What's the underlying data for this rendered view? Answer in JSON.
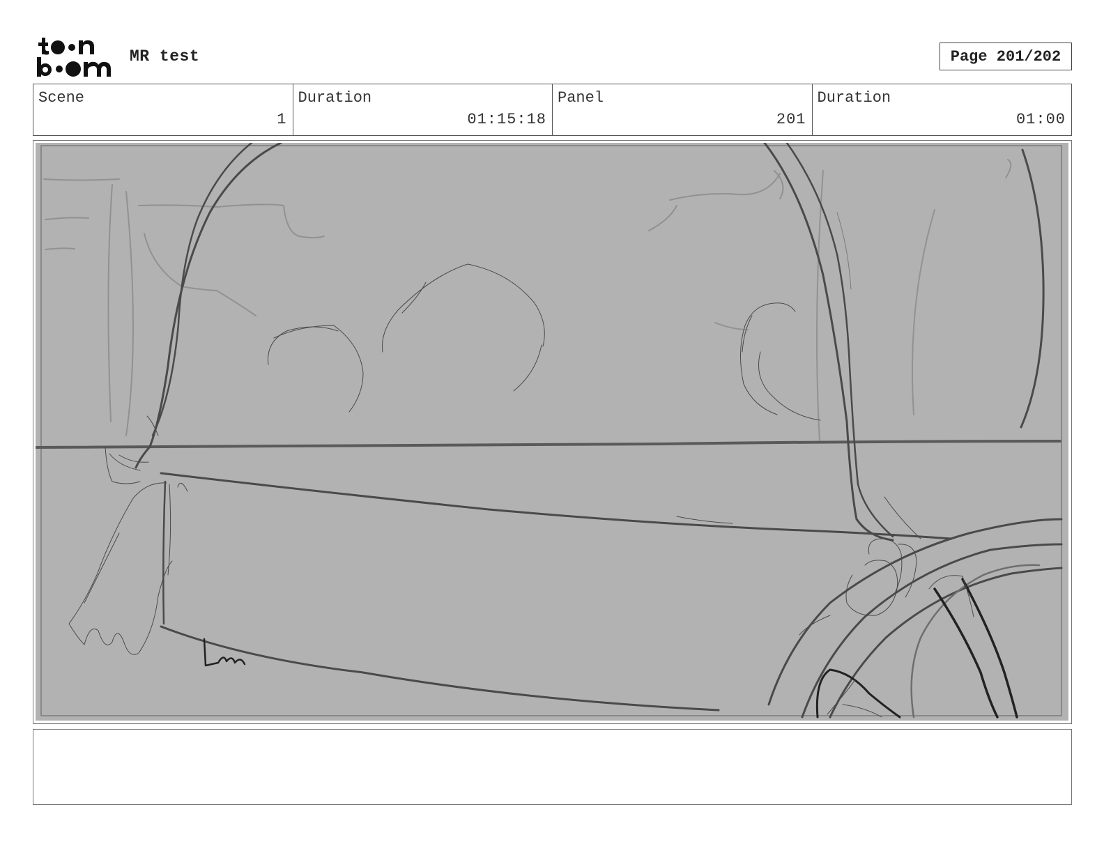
{
  "header": {
    "logo": {
      "text": "toon boom",
      "icon": "toon-boom-logo"
    },
    "project_title": "MR test",
    "page_indicator": "Page 201/202"
  },
  "info": {
    "scene_label": "Scene",
    "scene_value": "1",
    "duration_label": "Duration",
    "duration_value": "01:15:18",
    "panel_label": "Panel",
    "panel_value": "201",
    "panel_duration_label": "Duration",
    "panel_duration_value": "01:00"
  },
  "panel": {
    "background_color": "#b2b2b2",
    "sketch_stroke_color": "#4a4a4a"
  },
  "notes": {
    "text": ""
  }
}
